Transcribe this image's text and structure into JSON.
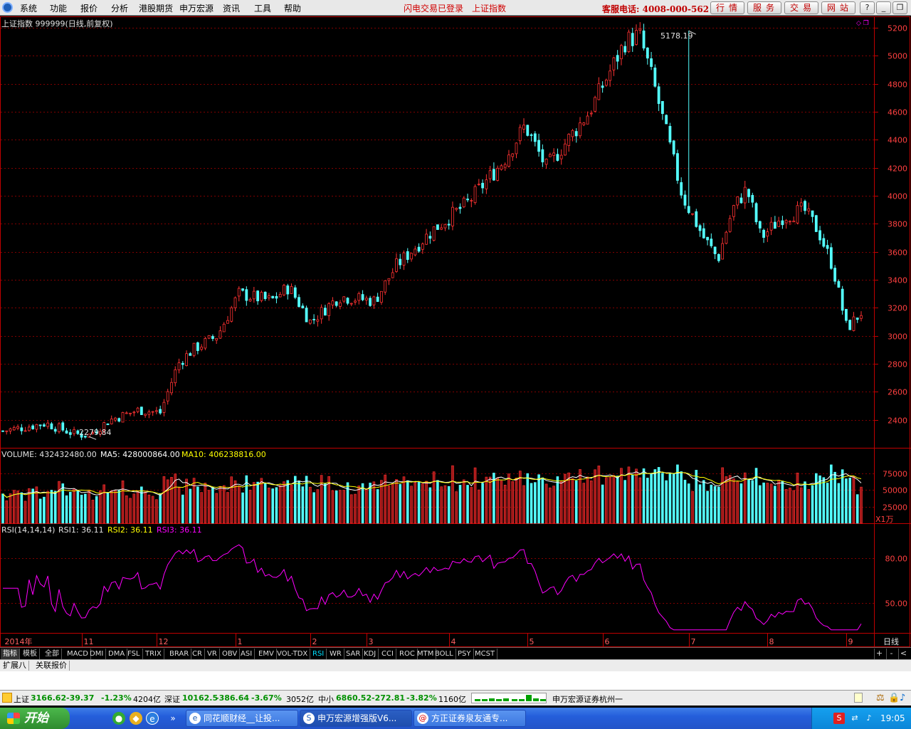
{
  "menubar": {
    "items": [
      "系统",
      "功能",
      "报价",
      "分析",
      "港股期货",
      "申万宏源",
      "资讯",
      "工具",
      "帮助"
    ],
    "status_login": "闪电交易已登录",
    "status_index": "上证指数",
    "hotline": "客服电话: 4008-000-562",
    "buttons": [
      "行情",
      "服务",
      "交易",
      "网站"
    ],
    "window_controls": [
      "?",
      "_",
      "❐",
      "X"
    ]
  },
  "chart": {
    "title": "上证指数 999999(日线,前复权)",
    "high_marker": "5178.19",
    "low_marker": "2279.84",
    "volume_label": "VOLUME: 432432480.00",
    "ma5_label": "MA5: 428000864.00",
    "ma10_label": "MA10: 406238816.00",
    "volume_unit": "X1万",
    "rsi_label": "RSI(14,14,14)",
    "rsi1_label": "RSI1: 36.11",
    "rsi2_label": "RSI2: 36.11",
    "rsi3_label": "RSI3: 36.11",
    "period_label": "日线",
    "colors": {
      "up": "#ff3232",
      "down": "#54ffff",
      "ma5": "#ffffff",
      "ma10": "#ffff00",
      "rsi": "#ff00ff",
      "grid": "#800000",
      "axis": "#c00000",
      "time_axis": "#ff6060"
    }
  },
  "tabs": {
    "items": [
      "指标",
      "模板",
      "全部",
      "MACD",
      "DMI",
      "DMA",
      "FSL",
      "TRIX",
      "BRAR",
      "CR",
      "VR",
      "OBV",
      "ASI",
      "EMV",
      "VOL-TDX",
      "RSI",
      "WR",
      "SAR",
      "KDJ",
      "CCI",
      "ROC",
      "MTM",
      "BOLL",
      "PSY",
      "MCST"
    ],
    "controls": [
      "+",
      "-",
      "<"
    ]
  },
  "ext_panel": {
    "tabs": [
      "扩展八",
      "关联报价"
    ]
  },
  "statusbar": {
    "sh_name": "上证",
    "sh_price": "3166.62",
    "sh_change": "-39.37",
    "sh_pct": "-1.23%",
    "sh_amount": "4204亿",
    "sz_name": "深证",
    "sz_price": "10162.5",
    "sz_change": "-386.64",
    "sz_pct": "-3.67%",
    "sz_amount": "3052亿",
    "zx_name": "中小",
    "zx_price": "6860.52",
    "zx_change": "-272.81",
    "zx_pct": "-3.82%",
    "zx_amount": "1160亿",
    "broker": "申万宏源证券杭州一"
  },
  "taskbar": {
    "start": "开始",
    "tasks": [
      "同花顺财经__让投...",
      "申万宏源增强版V6...",
      "方正证券泉友通专..."
    ],
    "clock": "19:05"
  },
  "chart_data": [
    {
      "type": "candlestick",
      "title": "上证指数 999999(日线,前复权)",
      "y_ticks": [
        2400,
        2600,
        2800,
        3000,
        3200,
        3400,
        3600,
        3800,
        4000,
        4200,
        4400,
        4600,
        4800,
        5000,
        5200
      ],
      "ylim": [
        2200,
        5240
      ],
      "x_ticks": [
        "2014年",
        "11",
        "12",
        "1",
        "2",
        "3",
        "4",
        "5",
        "6",
        "7",
        "8",
        "9"
      ],
      "x": [
        "2014-10",
        "2014-11",
        "2014-12",
        "2015-01",
        "2015-02",
        "2015-03",
        "2015-04",
        "2015-05",
        "2015-06",
        "2015-07",
        "2015-08",
        "2015-09"
      ],
      "close_approx": [
        2360,
        2450,
        2950,
        3300,
        3150,
        3500,
        4250,
        4500,
        5000,
        3700,
        3900,
        3166.62
      ],
      "high": 5178.19,
      "low": 2279.84,
      "grid": true
    },
    {
      "type": "bar",
      "title": "VOLUME",
      "y_ticks": [
        25000,
        50000,
        75000
      ],
      "unit": "X1万",
      "ylim": [
        0,
        90000
      ],
      "series": [
        {
          "name": "VOLUME",
          "last": 432432480.0
        },
        {
          "name": "MA5",
          "last": 428000864.0
        },
        {
          "name": "MA10",
          "last": 406238816.0
        }
      ]
    },
    {
      "type": "line",
      "title": "RSI(14,14,14)",
      "y_ticks": [
        50.0,
        80.0
      ],
      "ylim": [
        30,
        95
      ],
      "series": [
        {
          "name": "RSI1",
          "last": 36.11
        }
      ]
    }
  ]
}
